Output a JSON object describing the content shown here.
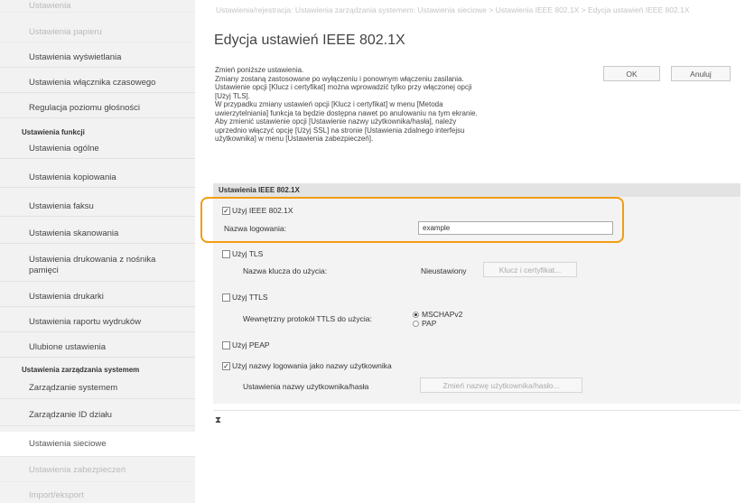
{
  "sidebar": {
    "items": [
      {
        "label": "Ustawienia",
        "state": "faded"
      },
      {
        "label": "Ustawienia papieru",
        "state": "faded"
      },
      {
        "label": "Ustawienia wyświetlania",
        "state": "normal"
      },
      {
        "label": "Ustawienia włącznika czasowego",
        "state": "normal"
      },
      {
        "label": "Regulacja poziomu głośności",
        "state": "normal"
      },
      {
        "label": "Ustawienia ogólne",
        "state": "normal"
      },
      {
        "label": "Ustawienia kopiowania",
        "state": "normal"
      },
      {
        "label": "Ustawienia faksu",
        "state": "normal"
      },
      {
        "label": "Ustawienia skanowania",
        "state": "normal"
      },
      {
        "label": "Ustawienia drukowania z nośnika pamięci",
        "state": "normal"
      },
      {
        "label": "Ustawienia drukarki",
        "state": "normal"
      },
      {
        "label": "Ustawienia raportu wydruków",
        "state": "normal"
      },
      {
        "label": "Ulubione ustawienia",
        "state": "normal"
      },
      {
        "label": "Zarządzanie systemem",
        "state": "normal"
      },
      {
        "label": "Zarządzanie ID działu",
        "state": "normal"
      },
      {
        "label": "Ustawienia sieciowe",
        "state": "active"
      },
      {
        "label": "Ustawienia zabezpieczeń",
        "state": "faded"
      },
      {
        "label": "Import/eksport",
        "state": "faded"
      }
    ],
    "section_functions": "Ustawienia funkcji",
    "section_management": "Ustawienia zarządzania systemem"
  },
  "breadcrumb": "Ustawienia/rejestracja: Ustawienia zarządzania systemem: Ustawienia sieciowe > Ustawienia IEEE 802.1X > Edycja ustawień IEEE 802.1X",
  "page_title": "Edycja ustawień IEEE 802.1X",
  "description": [
    "Zmień poniższe ustawienia.",
    "Zmiany zostaną zastosowane po wyłączeniu i ponownym włączeniu zasilania.",
    "Ustawienie opcji [Klucz i certyfikat] można wprowadzić tylko przy włączonej opcji",
    "[Użyj TLS].",
    "W przypadku zmiany ustawień opcji [Klucz i certyfikat] w menu [Metoda",
    "uwierzytelniania] funkcja ta będzie dostępna nawet po anulowaniu na tym ekranie.",
    "Aby zmienić ustawienie opcji [Ustawienie nazwy użytkownika/hasła], należy",
    "uprzednio włączyć opcję [Użyj SSL] na stronie [Ustawienia zdalnego interfejsu",
    "użytkownika] w menu [Ustawienia zabezpieczeń]."
  ],
  "buttons": {
    "ok": "OK",
    "cancel": "Anuluj"
  },
  "panel": {
    "header": "Ustawienia IEEE 802.1X",
    "use_ieee": {
      "label": "Użyj IEEE 802.1X",
      "checked": true
    },
    "login_name": {
      "label": "Nazwa logowania:",
      "value": "example"
    },
    "use_tls": {
      "label": "Użyj TLS",
      "checked": false
    },
    "key_label": "Nazwa klucza do użycia:",
    "key_status": "Nieustawiony",
    "key_button": "Klucz i certyfikat...",
    "use_ttls": {
      "label": "Użyj TTLS",
      "checked": false
    },
    "ttls_label": "Wewnętrzny protokół TTLS do użycia:",
    "ttls_options": [
      {
        "label": "MSCHAPv2",
        "selected": true
      },
      {
        "label": "PAP",
        "selected": false
      }
    ],
    "use_peap": {
      "label": "Użyj PEAP",
      "checked": false
    },
    "use_login_as_user": {
      "label": "Użyj nazwy logowania jako nazwy użytkownika",
      "checked": true
    },
    "user_pass_label": "Ustawienia nazwy użytkownika/hasła",
    "user_pass_button": "Zmień nazwę użytkownika/hasło..."
  },
  "top_icon": "⧗",
  "colors": {
    "highlight": "#f39c12",
    "sidebar_bg": "#f2f2f2",
    "panel_bg": "#f3f3f3"
  }
}
